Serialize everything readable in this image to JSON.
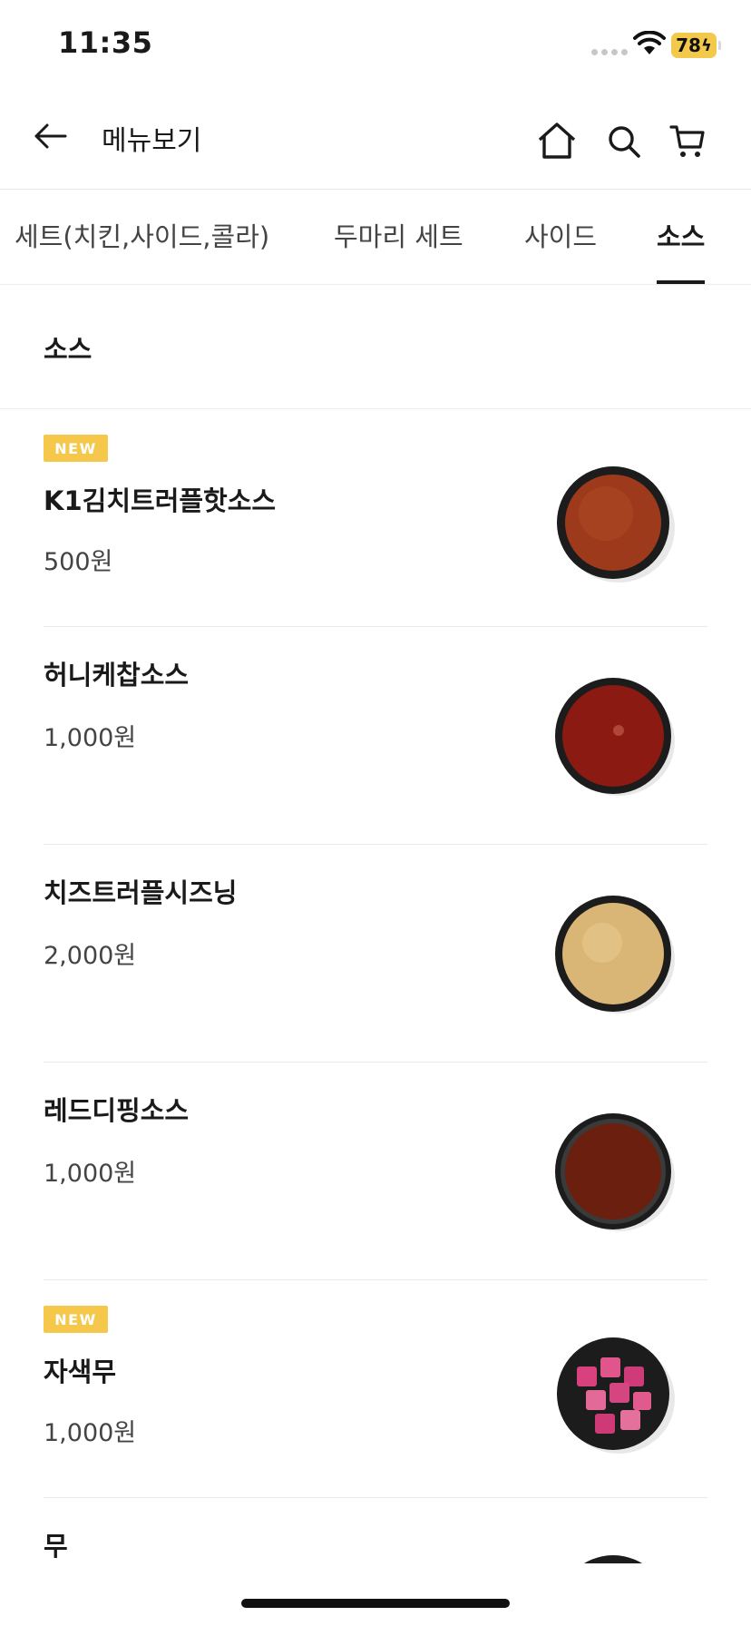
{
  "status_bar": {
    "time": "11:35",
    "battery": "78"
  },
  "header": {
    "title": "메뉴보기",
    "back_icon": "arrow-left-icon",
    "home_icon": "home-icon",
    "search_icon": "search-icon",
    "cart_icon": "cart-icon"
  },
  "tabs": [
    {
      "label": "세트(치킨,사이드,콜라)",
      "active": false
    },
    {
      "label": "두마리 세트",
      "active": false
    },
    {
      "label": "사이드",
      "active": false
    },
    {
      "label": "소스",
      "active": true
    }
  ],
  "section": {
    "title": "소스"
  },
  "badge_label": "NEW",
  "items": [
    {
      "name": "K1김치트러플핫소스",
      "price": "500원",
      "is_new": true,
      "image": "red-sauce-bowl"
    },
    {
      "name": "허니케찹소스",
      "price": "1,000원",
      "is_new": false,
      "image": "ketchup-sauce-bowl"
    },
    {
      "name": "치즈트러플시즈닝",
      "price": "2,000원",
      "is_new": false,
      "image": "seasoning-powder-bowl"
    },
    {
      "name": "레드디핑소스",
      "price": "1,000원",
      "is_new": false,
      "image": "dipping-sauce-bowl"
    },
    {
      "name": "자색무",
      "price": "1,000원",
      "is_new": true,
      "image": "purple-radish-bowl"
    },
    {
      "name": "무",
      "price": "",
      "is_new": false,
      "image": "radish-bowl"
    }
  ],
  "colors": {
    "badge": "#f5c84c",
    "battery": "#f3c94b",
    "text_primary": "#1a1a1a",
    "text_secondary": "#444444",
    "divider": "#e9e9e9"
  }
}
